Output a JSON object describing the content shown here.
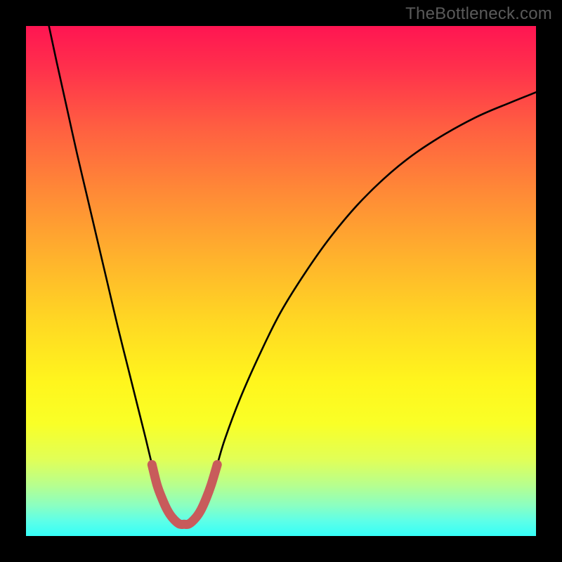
{
  "watermark": "TheBottleneck.com",
  "colors": {
    "background": "#000000",
    "gradient_top": "#ff1552",
    "gradient_bottom": "#35fff9",
    "curve_stroke": "#000000",
    "thick_band_stroke": "#c85b5b"
  },
  "chart_data": {
    "type": "line",
    "title": "",
    "xlabel": "",
    "ylabel": "",
    "xlim": [
      0,
      100
    ],
    "ylim": [
      0,
      100
    ],
    "series": [
      {
        "name": "left-branch",
        "x": [
          4.5,
          6,
          8,
          10,
          12,
          14,
          16,
          18,
          20,
          22,
          23.5,
          24.7,
          25.7,
          26.7,
          27.7,
          28.7,
          30.0,
          31.0
        ],
        "y": [
          100,
          93,
          84,
          75,
          66.5,
          58,
          49.5,
          41,
          33,
          25,
          19,
          14,
          10,
          7.3,
          5.1,
          3.6,
          2.4,
          2.3
        ]
      },
      {
        "name": "right-branch",
        "x": [
          31.0,
          32.3,
          33.3,
          34.3,
          35.3,
          36.3,
          37.5,
          39,
          42,
          46,
          50,
          55,
          60,
          66,
          73,
          80,
          88,
          95,
          100
        ],
        "y": [
          2.3,
          2.4,
          3.6,
          5.1,
          7.3,
          10,
          14,
          19,
          27,
          36,
          44,
          52,
          59,
          66,
          72.5,
          77.5,
          82,
          85,
          87
        ]
      },
      {
        "name": "thick-band",
        "x": [
          24.7,
          25.7,
          26.7,
          27.7,
          28.7,
          30.0,
          31.0,
          32.0,
          33.3,
          34.3,
          35.3,
          36.3,
          37.5
        ],
        "y": [
          14,
          10,
          7.3,
          5.1,
          3.6,
          2.4,
          2.3,
          2.4,
          3.6,
          5.1,
          7.3,
          10,
          14
        ]
      }
    ],
    "minimum": {
      "x": 31.0,
      "y": 2.3
    }
  }
}
